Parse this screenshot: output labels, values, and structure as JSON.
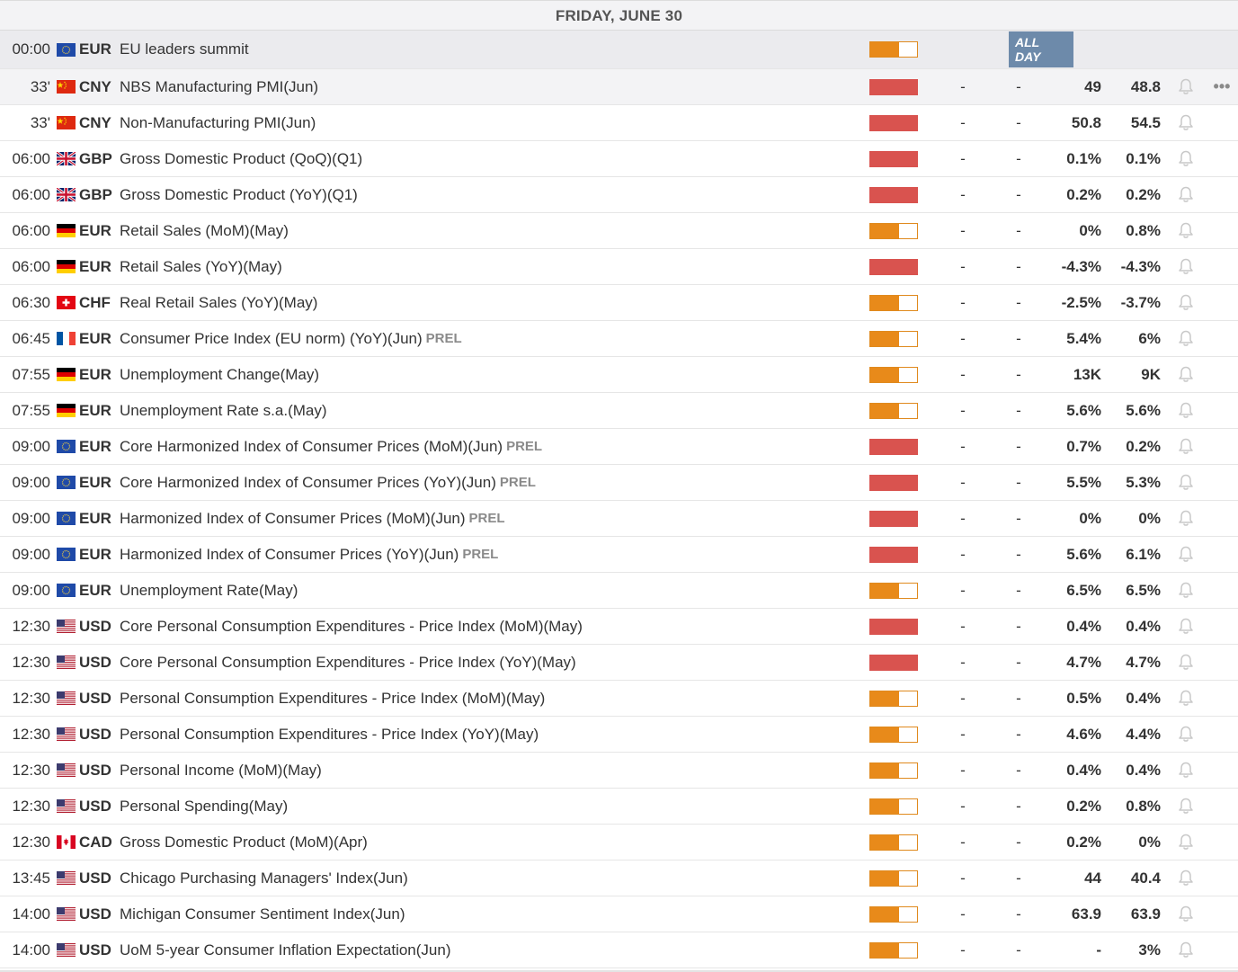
{
  "day_header": "FRIDAY, JUNE 30",
  "allday_label": "ALL DAY",
  "more_glyph": "•••",
  "colors": {
    "high_impact": "#d9534f",
    "medium_impact": "#e88a1a",
    "allday_badge": "#6d8aaa",
    "header_bg": "#f3f3f5"
  },
  "events": [
    {
      "time": "00:00",
      "flag": "eu",
      "currency": "EUR",
      "name": "EU leaders summit",
      "prel": "",
      "impact": "medium",
      "actual": "",
      "consensus": "",
      "previous": "",
      "forecast": "",
      "allday": true
    },
    {
      "time": "33'",
      "flag": "cn",
      "currency": "CNY",
      "name": "NBS Manufacturing PMI(Jun)",
      "prel": "",
      "impact": "high",
      "actual": "-",
      "consensus": "-",
      "previous": "49",
      "forecast": "48.8",
      "highlight": true
    },
    {
      "time": "33'",
      "flag": "cn",
      "currency": "CNY",
      "name": "Non-Manufacturing PMI(Jun)",
      "prel": "",
      "impact": "high",
      "actual": "-",
      "consensus": "-",
      "previous": "50.8",
      "forecast": "54.5"
    },
    {
      "time": "06:00",
      "flag": "gb",
      "currency": "GBP",
      "name": "Gross Domestic Product (QoQ)(Q1)",
      "prel": "",
      "impact": "high",
      "actual": "-",
      "consensus": "-",
      "previous": "0.1%",
      "forecast": "0.1%"
    },
    {
      "time": "06:00",
      "flag": "gb",
      "currency": "GBP",
      "name": "Gross Domestic Product (YoY)(Q1)",
      "prel": "",
      "impact": "high",
      "actual": "-",
      "consensus": "-",
      "previous": "0.2%",
      "forecast": "0.2%"
    },
    {
      "time": "06:00",
      "flag": "de",
      "currency": "EUR",
      "name": "Retail Sales (MoM)(May)",
      "prel": "",
      "impact": "medium",
      "actual": "-",
      "consensus": "-",
      "previous": "0%",
      "forecast": "0.8%"
    },
    {
      "time": "06:00",
      "flag": "de",
      "currency": "EUR",
      "name": "Retail Sales (YoY)(May)",
      "prel": "",
      "impact": "high",
      "actual": "-",
      "consensus": "-",
      "previous": "-4.3%",
      "forecast": "-4.3%"
    },
    {
      "time": "06:30",
      "flag": "ch",
      "currency": "CHF",
      "name": "Real Retail Sales (YoY)(May)",
      "prel": "",
      "impact": "medium",
      "actual": "-",
      "consensus": "-",
      "previous": "-2.5%",
      "forecast": "-3.7%"
    },
    {
      "time": "06:45",
      "flag": "fr",
      "currency": "EUR",
      "name": "Consumer Price Index (EU norm) (YoY)(Jun)",
      "prel": "PREL",
      "impact": "medium",
      "actual": "-",
      "consensus": "-",
      "previous": "5.4%",
      "forecast": "6%"
    },
    {
      "time": "07:55",
      "flag": "de",
      "currency": "EUR",
      "name": "Unemployment Change(May)",
      "prel": "",
      "impact": "medium",
      "actual": "-",
      "consensus": "-",
      "previous": "13K",
      "forecast": "9K"
    },
    {
      "time": "07:55",
      "flag": "de",
      "currency": "EUR",
      "name": "Unemployment Rate s.a.(May)",
      "prel": "",
      "impact": "medium",
      "actual": "-",
      "consensus": "-",
      "previous": "5.6%",
      "forecast": "5.6%"
    },
    {
      "time": "09:00",
      "flag": "eu",
      "currency": "EUR",
      "name": "Core Harmonized Index of Consumer Prices (MoM)(Jun)",
      "prel": "PREL",
      "impact": "high",
      "actual": "-",
      "consensus": "-",
      "previous": "0.7%",
      "forecast": "0.2%"
    },
    {
      "time": "09:00",
      "flag": "eu",
      "currency": "EUR",
      "name": "Core Harmonized Index of Consumer Prices (YoY)(Jun)",
      "prel": "PREL",
      "impact": "high",
      "actual": "-",
      "consensus": "-",
      "previous": "5.5%",
      "forecast": "5.3%"
    },
    {
      "time": "09:00",
      "flag": "eu",
      "currency": "EUR",
      "name": "Harmonized Index of Consumer Prices (MoM)(Jun)",
      "prel": "PREL",
      "impact": "high",
      "actual": "-",
      "consensus": "-",
      "previous": "0%",
      "forecast": "0%"
    },
    {
      "time": "09:00",
      "flag": "eu",
      "currency": "EUR",
      "name": "Harmonized Index of Consumer Prices (YoY)(Jun)",
      "prel": "PREL",
      "impact": "high",
      "actual": "-",
      "consensus": "-",
      "previous": "5.6%",
      "forecast": "6.1%"
    },
    {
      "time": "09:00",
      "flag": "eu",
      "currency": "EUR",
      "name": "Unemployment Rate(May)",
      "prel": "",
      "impact": "medium",
      "actual": "-",
      "consensus": "-",
      "previous": "6.5%",
      "forecast": "6.5%"
    },
    {
      "time": "12:30",
      "flag": "us",
      "currency": "USD",
      "name": "Core Personal Consumption Expenditures - Price Index (MoM)(May)",
      "prel": "",
      "impact": "high",
      "actual": "-",
      "consensus": "-",
      "previous": "0.4%",
      "forecast": "0.4%"
    },
    {
      "time": "12:30",
      "flag": "us",
      "currency": "USD",
      "name": "Core Personal Consumption Expenditures - Price Index (YoY)(May)",
      "prel": "",
      "impact": "high",
      "actual": "-",
      "consensus": "-",
      "previous": "4.7%",
      "forecast": "4.7%"
    },
    {
      "time": "12:30",
      "flag": "us",
      "currency": "USD",
      "name": "Personal Consumption Expenditures - Price Index (MoM)(May)",
      "prel": "",
      "impact": "medium",
      "actual": "-",
      "consensus": "-",
      "previous": "0.5%",
      "forecast": "0.4%"
    },
    {
      "time": "12:30",
      "flag": "us",
      "currency": "USD",
      "name": "Personal Consumption Expenditures - Price Index (YoY)(May)",
      "prel": "",
      "impact": "medium",
      "actual": "-",
      "consensus": "-",
      "previous": "4.6%",
      "forecast": "4.4%"
    },
    {
      "time": "12:30",
      "flag": "us",
      "currency": "USD",
      "name": "Personal Income (MoM)(May)",
      "prel": "",
      "impact": "medium",
      "actual": "-",
      "consensus": "-",
      "previous": "0.4%",
      "forecast": "0.4%"
    },
    {
      "time": "12:30",
      "flag": "us",
      "currency": "USD",
      "name": "Personal Spending(May)",
      "prel": "",
      "impact": "medium",
      "actual": "-",
      "consensus": "-",
      "previous": "0.2%",
      "forecast": "0.8%"
    },
    {
      "time": "12:30",
      "flag": "ca",
      "currency": "CAD",
      "name": "Gross Domestic Product (MoM)(Apr)",
      "prel": "",
      "impact": "medium",
      "actual": "-",
      "consensus": "-",
      "previous": "0.2%",
      "forecast": "0%"
    },
    {
      "time": "13:45",
      "flag": "us",
      "currency": "USD",
      "name": "Chicago Purchasing Managers' Index(Jun)",
      "prel": "",
      "impact": "medium",
      "actual": "-",
      "consensus": "-",
      "previous": "44",
      "forecast": "40.4"
    },
    {
      "time": "14:00",
      "flag": "us",
      "currency": "USD",
      "name": "Michigan Consumer Sentiment Index(Jun)",
      "prel": "",
      "impact": "medium",
      "actual": "-",
      "consensus": "-",
      "previous": "63.9",
      "forecast": "63.9"
    },
    {
      "time": "14:00",
      "flag": "us",
      "currency": "USD",
      "name": "UoM 5-year Consumer Inflation Expectation(Jun)",
      "prel": "",
      "impact": "medium",
      "actual": "-",
      "consensus": "-",
      "previous": "-",
      "forecast": "3%"
    }
  ]
}
